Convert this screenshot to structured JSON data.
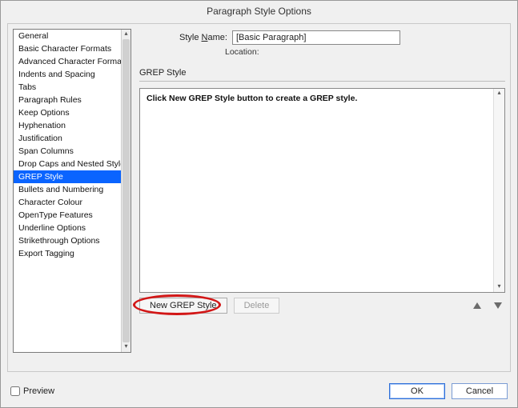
{
  "dialog": {
    "title": "Paragraph Style Options"
  },
  "sidebar": {
    "items": [
      {
        "label": "General"
      },
      {
        "label": "Basic Character Formats"
      },
      {
        "label": "Advanced Character Formats"
      },
      {
        "label": "Indents and Spacing"
      },
      {
        "label": "Tabs"
      },
      {
        "label": "Paragraph Rules"
      },
      {
        "label": "Keep Options"
      },
      {
        "label": "Hyphenation"
      },
      {
        "label": "Justification"
      },
      {
        "label": "Span Columns"
      },
      {
        "label": "Drop Caps and Nested Styles"
      },
      {
        "label": "GREP Style",
        "selected": true
      },
      {
        "label": "Bullets and Numbering"
      },
      {
        "label": "Character Colour"
      },
      {
        "label": "OpenType Features"
      },
      {
        "label": "Underline Options"
      },
      {
        "label": "Strikethrough Options"
      },
      {
        "label": "Export Tagging"
      }
    ]
  },
  "name_row": {
    "label_prefix": "Style ",
    "label_u": "N",
    "label_suffix": "ame:",
    "value": "[Basic Paragraph]"
  },
  "location_row": {
    "label": "Location:"
  },
  "section": {
    "heading": "GREP Style"
  },
  "grep_box": {
    "hint": "Click New GREP Style button to create a GREP style."
  },
  "buttons": {
    "new_grep": "New GREP Style",
    "delete": "Delete"
  },
  "footer": {
    "preview": "Preview",
    "ok": "OK",
    "cancel": "Cancel"
  }
}
